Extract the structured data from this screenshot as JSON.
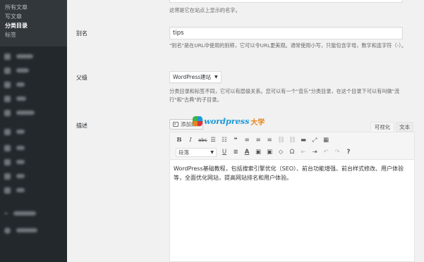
{
  "sidebar": {
    "submenu": [
      {
        "label": "所有文章",
        "current": false
      },
      {
        "label": "写文章",
        "current": false
      },
      {
        "label": "分类目录",
        "current": true
      },
      {
        "label": "标签",
        "current": false
      }
    ],
    "menu_count": 12
  },
  "form": {
    "name_description": "这将是它在站点上显示的名字。",
    "slug": {
      "label": "别名",
      "value": "tips",
      "description": "\"别名\"是在URL中使用的别称，它可以令URL更美观。通常使用小写，只能包含字母，数字和连字符（-）。"
    },
    "parent": {
      "label": "父级",
      "value": "WordPress建站",
      "description": "分类目录和标签不同，它可以有层级关系。您可以有一个\"音乐\"分类目录，在这个目录下可以有叫做\"流行\"和\"古典\"的子目录。"
    },
    "description_field": {
      "label": "描述",
      "add_media_label": "添加媒体",
      "tab_visual": "可视化",
      "tab_text": "文本",
      "format_select": "段落",
      "content": "WordPress基础教程，包括搜索引擎优化（SEO）、前台功能增强、前台样式修改、用户体验等，全面优化网站，提高网站排名和用户体验。"
    }
  },
  "watermark": {
    "text": "wordpress",
    "suffix": "大学"
  },
  "colors": {
    "sidebar_bg": "#23282d",
    "submenu_bg": "#32373c",
    "accent": "#1e9ad6",
    "watermark_orange": "#e8831a"
  }
}
